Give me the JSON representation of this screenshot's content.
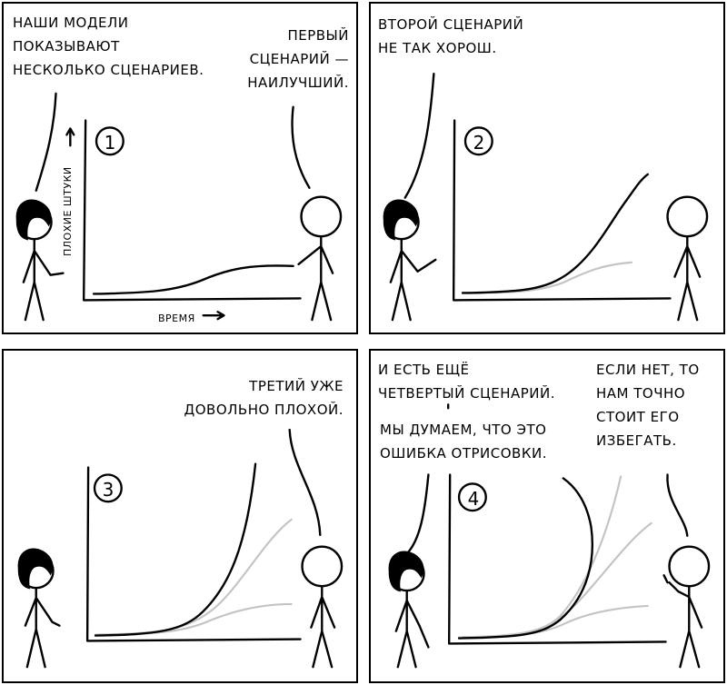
{
  "panels": [
    {
      "number": "1",
      "left_text": "НАШИ МОДЕЛИ\nПОКАЗЫВАЮТ\nНЕСКОЛЬКО СЦЕНАРИЕВ.",
      "right_text": "ПЕРВЫЙ\nСЦЕНАРИЙ —\nНАИЛУЧШИЙ.",
      "y_axis_label": "ПЛОХИЕ ШТУКИ",
      "x_axis_label": "ВРЕМЯ"
    },
    {
      "number": "2",
      "left_text": "ВТОРОЙ СЦЕНАРИЙ\nНЕ ТАК ХОРОШ."
    },
    {
      "number": "3",
      "right_text": "ТРЕТИЙ УЖЕ\nДОВОЛЬНО ПЛОХОЙ."
    },
    {
      "number": "4",
      "left_text": "И ЕСТЬ ЕЩЁ\nЧЕТВЕРТЫЙ СЦЕНАРИЙ.",
      "left_text_2": "МЫ ДУМАЕМ, ЧТО ЭТО\nОШИБКА ОТРИСОВКИ.",
      "right_text": "ЕСЛИ НЕТ, ТО\nНАМ ТОЧНО\nСТОИТ ЕГО\nИЗБЕГАТЬ."
    }
  ]
}
